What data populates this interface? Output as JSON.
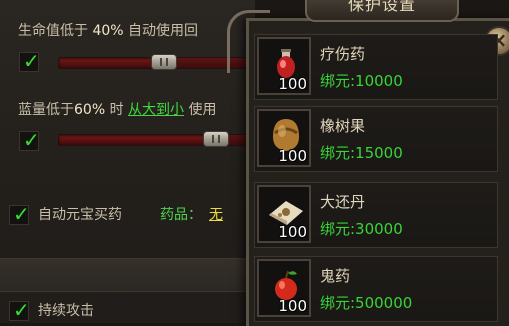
{
  "settings": {
    "hp_line": {
      "prefix": "生命值低于",
      "percent": "40%",
      "suffix": "自动使用回",
      "slider_level": 0.5
    },
    "mp_line": {
      "prefix": "蓝量低于",
      "percent": "60%",
      "mid": "时",
      "order_link": "从大到小",
      "suffix": "使用",
      "slider_level": 0.78
    },
    "auto_buy": {
      "label": "自动元宝买药",
      "drug_label": "药品：",
      "drug_value": "无"
    },
    "continuous_attack": {
      "label": "持续攻击"
    }
  },
  "popup": {
    "title": "保护设置",
    "close_symbol": "×",
    "items": [
      {
        "name": "疗伤药",
        "qty": "100",
        "price": "绑元:10000",
        "icon": "red-potion-icon"
      },
      {
        "name": "橡树果",
        "qty": "100",
        "price": "绑元:15000",
        "icon": "acorn-icon"
      },
      {
        "name": "大还丹",
        "qty": "100",
        "price": "绑元:30000",
        "icon": "pill-packet-icon"
      },
      {
        "name": "鬼药",
        "qty": "100",
        "price": "绑元:500000",
        "icon": "red-fruit-icon"
      }
    ]
  },
  "colors": {
    "accent_green": "#38d438",
    "link_green": "#3fdc3f",
    "slider_red": "#7a1b1b",
    "checkmark": "#36e12e"
  }
}
